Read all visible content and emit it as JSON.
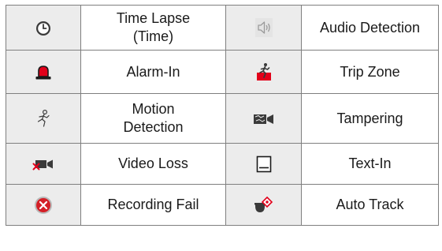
{
  "rows": [
    {
      "left": {
        "icon": "clock-icon",
        "label": "Time Lapse\n(Time)"
      },
      "right": {
        "icon": "speaker-icon",
        "label": "Audio Detection"
      }
    },
    {
      "left": {
        "icon": "alarm-light-icon",
        "label": "Alarm-In"
      },
      "right": {
        "icon": "trip-zone-icon",
        "label": "Trip Zone"
      }
    },
    {
      "left": {
        "icon": "running-person-icon",
        "label": "Motion\nDetection"
      },
      "right": {
        "icon": "tampered-camera-icon",
        "label": "Tampering"
      }
    },
    {
      "left": {
        "icon": "camera-crossed-icon",
        "label": "Video Loss"
      },
      "right": {
        "icon": "text-box-icon",
        "label": "Text-In"
      }
    },
    {
      "left": {
        "icon": "record-fail-icon",
        "label": "Recording Fail"
      },
      "right": {
        "icon": "ptz-camera-icon",
        "label": "Auto Track"
      }
    }
  ],
  "colors": {
    "alarm_red": "#e2001a",
    "fail_red": "#d41f26",
    "icon_dark": "#3a3a3a",
    "speaker_gray": "#9a9a9a"
  }
}
